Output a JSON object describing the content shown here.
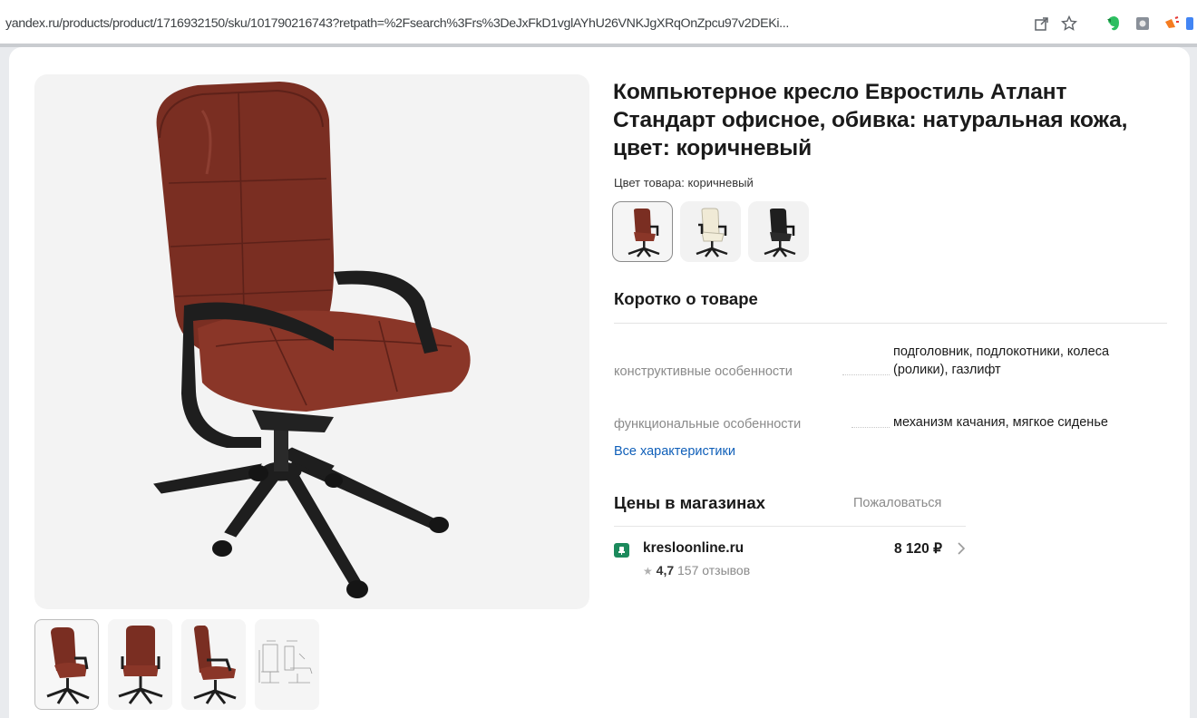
{
  "browser": {
    "url": "yandex.ru/products/product/1716932150/sku/101790216743?retpath=%2Fsearch%3Frs%3DeJxFkD1vglAYhU26VNKJgXRqOnZpcu97v2DEKi..."
  },
  "product": {
    "title": "Компьютерное кресло Евростиль Атлант Стандарт офисное, обивка: натуральная кожа, цвет: коричневый",
    "color_label": "Цвет товара: коричневый",
    "color_options": [
      "коричневый",
      "бежевый",
      "черный"
    ],
    "brief_heading": "Коротко о товаре",
    "specs": [
      {
        "key": "конструктивные особенности",
        "value": "подголовник, подлокотники, колеса (ролики), газлифт"
      },
      {
        "key": "функциональные особенности",
        "value": "механизм качания, мягкое сиденье"
      }
    ],
    "all_specs_link": "Все характеристики"
  },
  "prices": {
    "heading": "Цены в магазинах",
    "complain": "Пожаловаться",
    "offers": [
      {
        "shop": "kresloonline.ru",
        "rating": "4,7",
        "reviews": "157 отзывов",
        "price": "8 120 ₽"
      }
    ]
  },
  "colors": {
    "chair_leather": "#7a2e22",
    "chair_frame": "#1e1e1e",
    "link": "#0f5fb9",
    "shop_icon": "#1c8a5c"
  }
}
